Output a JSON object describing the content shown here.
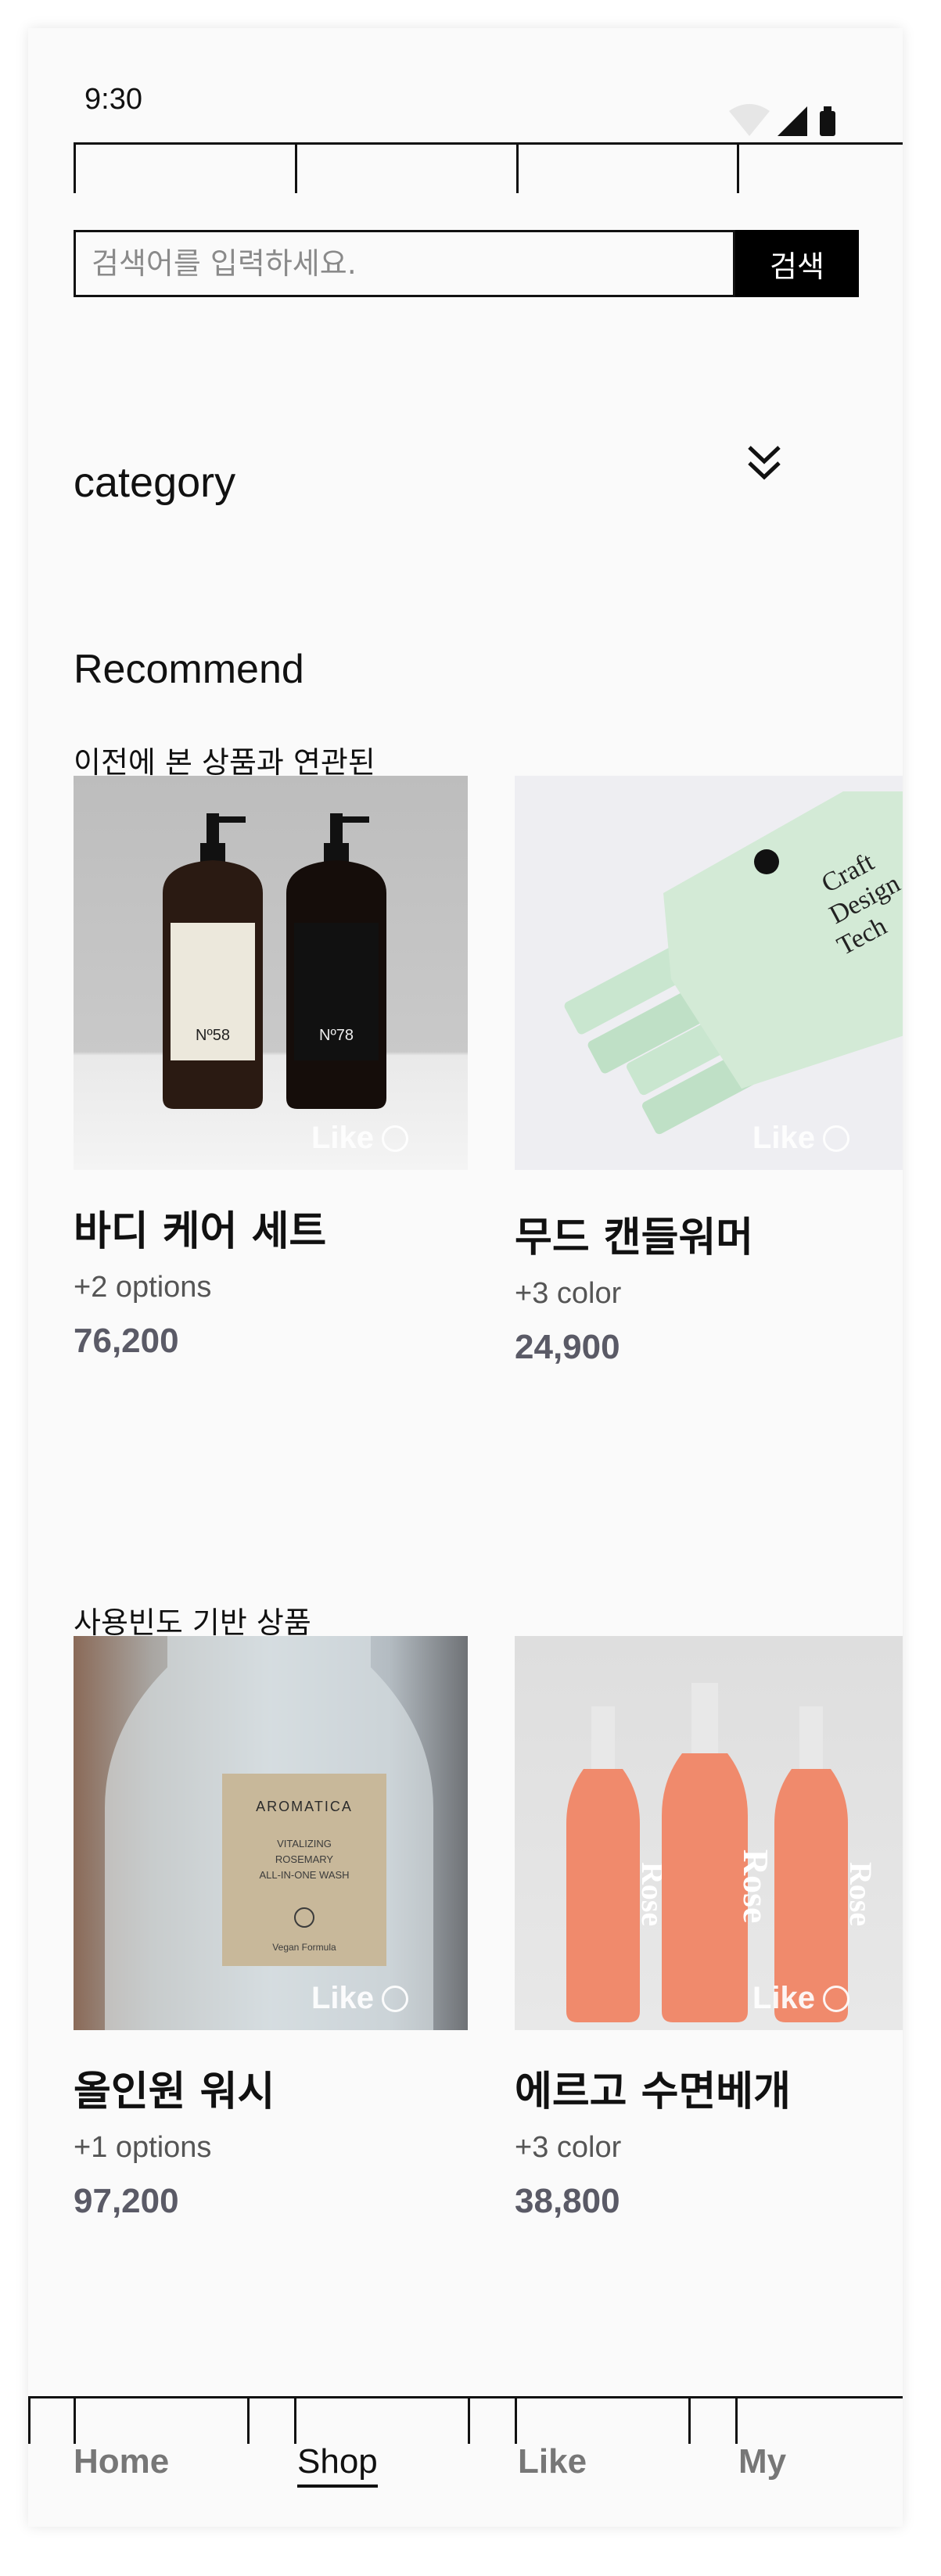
{
  "status_bar": {
    "time": "9:30"
  },
  "search": {
    "placeholder": "검색어를 입력하세요.",
    "button_label": "검색"
  },
  "category": {
    "title": "category"
  },
  "recommend": {
    "title": "Recommend",
    "sections": [
      {
        "subtitle": "이전에 본 상품과 연관된",
        "products": [
          {
            "name": "바디 케어 세트",
            "options": "+2 options",
            "price": "76,200",
            "like_label": "Like",
            "image_labels": [
              "Nº58",
              "Nº78"
            ]
          },
          {
            "name": "무드 캔들워머",
            "options": "+3 color",
            "price": "24,900",
            "like_label": "Like",
            "image_labels": [
              "Craft",
              "Design",
              "Tech"
            ]
          }
        ]
      },
      {
        "subtitle": "사용빈도 기반 상품",
        "products": [
          {
            "name": "올인원 워시",
            "options": "+1 options",
            "price": "97,200",
            "like_label": "Like",
            "image_labels": [
              "AROMATICA",
              "VITALIZING",
              "ROSEMARY",
              "ALL-IN-ONE WASH",
              "Vegan Formula"
            ]
          },
          {
            "name": "에르고 수면베개",
            "options": "+3 color",
            "price": "38,800",
            "like_label": "Like",
            "image_labels": [
              "Rose",
              "Rose",
              "Rose"
            ]
          }
        ]
      }
    ]
  },
  "bottom_nav": {
    "items": [
      "Home",
      "Shop",
      "Like",
      "My"
    ],
    "active": "Shop"
  },
  "colors": {
    "accent": "#000000",
    "background": "#fafafa",
    "price": "#5a5a66"
  }
}
